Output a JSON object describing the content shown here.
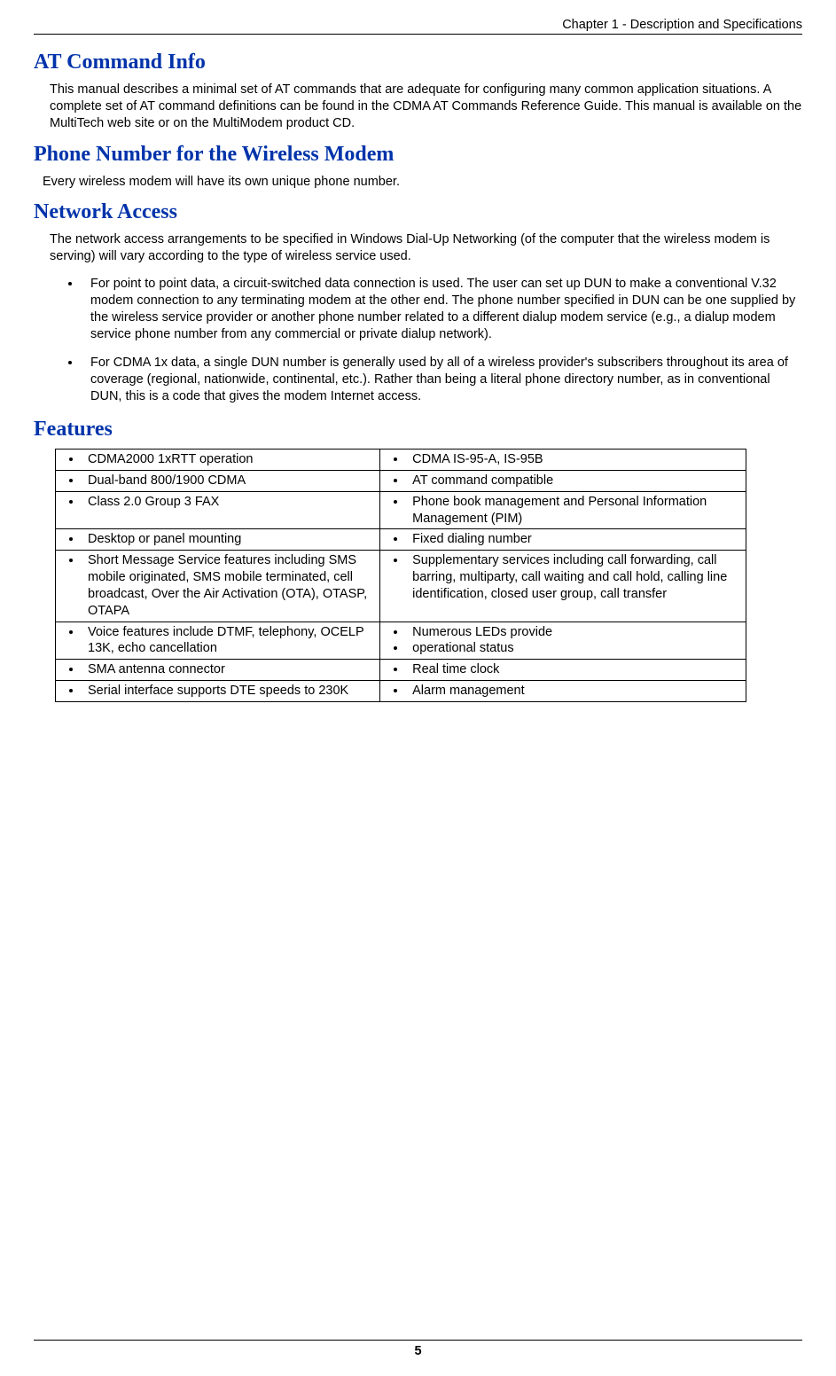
{
  "header": {
    "chapter": "Chapter 1 - Description and Specifications"
  },
  "sections": {
    "at_command": {
      "heading": "AT Command Info",
      "body": "This manual describes a minimal set of AT commands that are adequate for configuring many common application situations.  A complete set of AT command definitions can be found in the CDMA AT Commands Reference Guide.  This manual is available on the MultiTech web site or on the MultiModem product CD."
    },
    "phone_number": {
      "heading": "Phone Number for the Wireless Modem",
      "body": "Every wireless modem will have its own unique phone number."
    },
    "network_access": {
      "heading": "Network Access",
      "intro": "The network access arrangements to be specified in Windows Dial-Up Networking (of the computer that the wireless modem is serving) will vary according to the type of wireless service used.",
      "bullets": [
        "For point to point data, a circuit-switched data connection is used. The user can set up DUN to make a conventional V.32 modem connection to any terminating modem at the other end. The phone number specified in DUN can be one supplied by the wireless service provider or another phone number related to a different dialup modem service (e.g., a dialup modem service phone number from any commercial or private dialup network).",
        "For CDMA 1x data, a single DUN number is generally used by all of a wireless provider's subscribers throughout its area of coverage (regional, nationwide, continental, etc.). Rather than being a literal phone directory number, as in conventional DUN, this is a code that gives the modem Internet access."
      ]
    },
    "features": {
      "heading": "Features",
      "rows": [
        {
          "left": [
            "CDMA2000 1xRTT operation"
          ],
          "right": [
            "CDMA IS-95-A, IS-95B"
          ]
        },
        {
          "left": [
            "Dual-band 800/1900 CDMA"
          ],
          "right": [
            "AT command compatible"
          ]
        },
        {
          "left": [
            "Class 2.0 Group 3 FAX"
          ],
          "right": [
            "Phone book management and Personal Information Management (PIM)"
          ]
        },
        {
          "left": [
            "Desktop or panel mounting"
          ],
          "right": [
            "Fixed dialing number"
          ]
        },
        {
          "left": [
            "Short Message Service features including SMS mobile originated, SMS mobile terminated, cell broadcast, Over the Air Activation (OTA), OTASP, OTAPA"
          ],
          "right": [
            "Supplementary services including call forwarding, call barring, multiparty, call waiting and call hold, calling line identification, closed user group, call transfer"
          ]
        },
        {
          "left": [
            "Voice features include DTMF, telephony, OCELP 13K, echo cancellation"
          ],
          "right": [
            "Numerous LEDs provide",
            "operational status"
          ]
        },
        {
          "left": [
            "SMA antenna connector"
          ],
          "right": [
            "Real time clock"
          ]
        },
        {
          "left": [
            "Serial interface supports DTE speeds to 230K"
          ],
          "right": [
            "Alarm management"
          ]
        }
      ]
    }
  },
  "footer": {
    "page_number": "5"
  }
}
